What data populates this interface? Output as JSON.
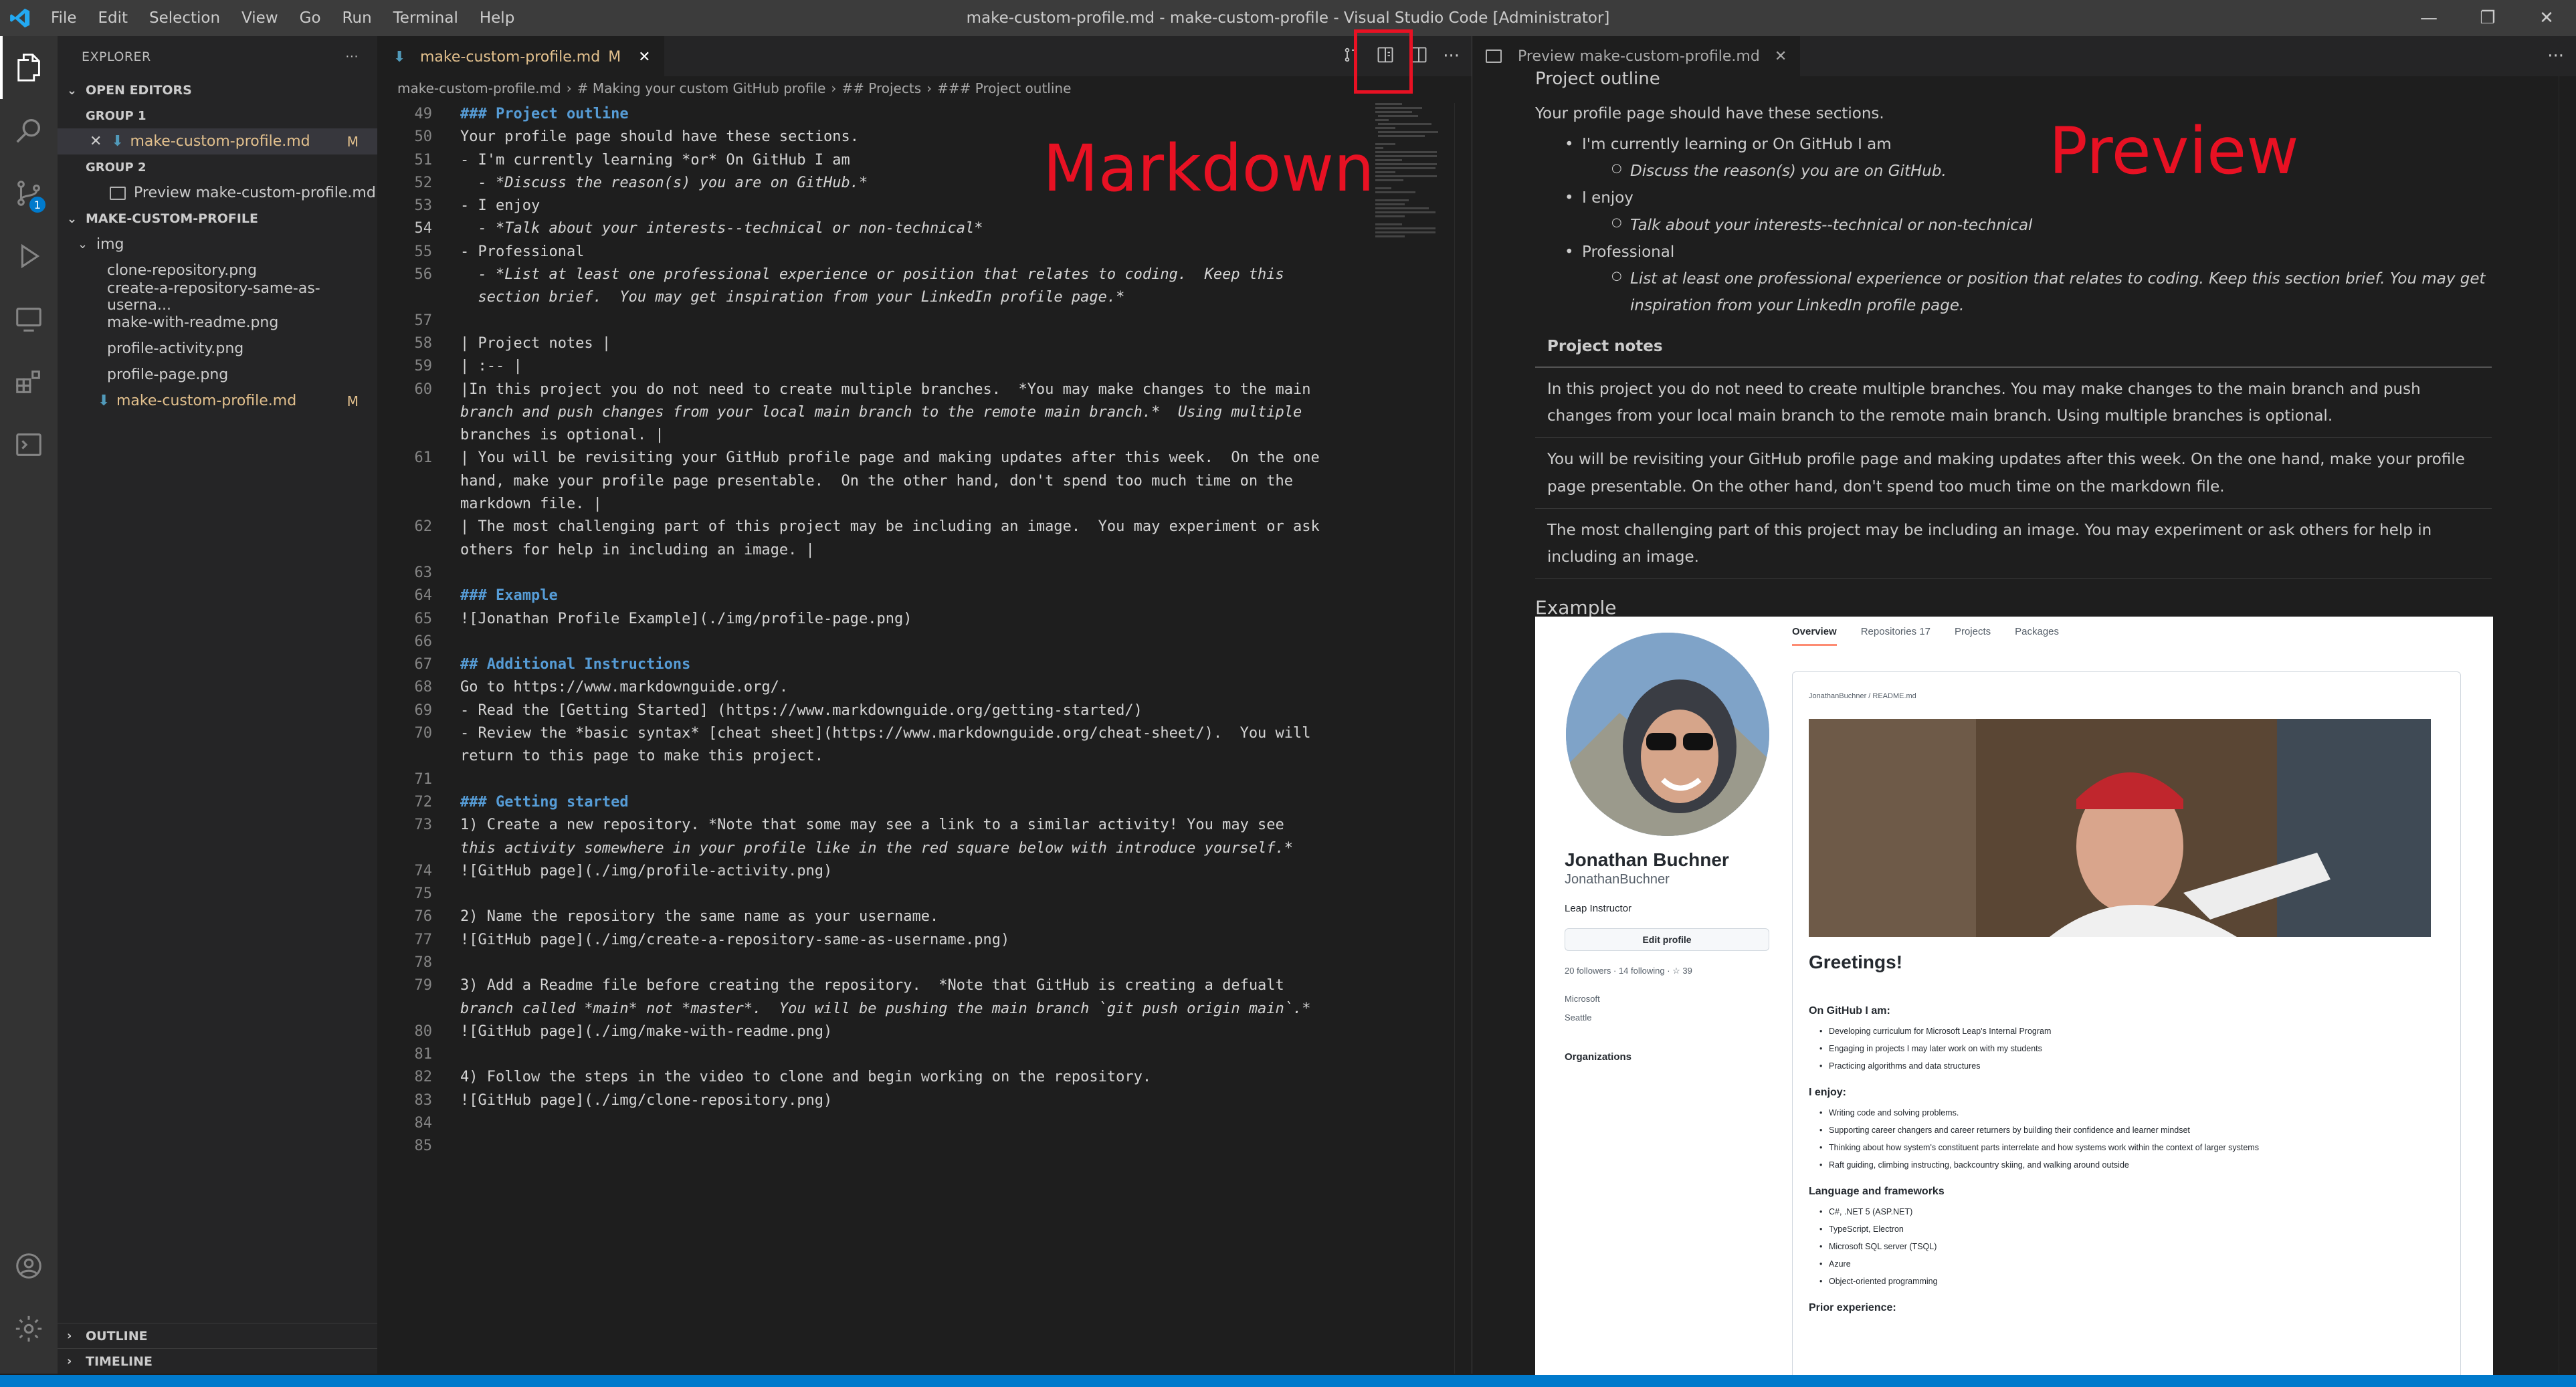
{
  "window": {
    "title": "make-custom-profile.md - make-custom-profile - Visual Studio Code [Administrator]",
    "menu": [
      "File",
      "Edit",
      "Selection",
      "View",
      "Go",
      "Run",
      "Terminal",
      "Help"
    ]
  },
  "activity": {
    "scm_badge": "1"
  },
  "sidebar": {
    "header": "EXPLORER",
    "open_editors": "OPEN EDITORS",
    "group1": "GROUP 1",
    "group1_file": "make-custom-profile.md",
    "group1_mod": "M",
    "group2": "GROUP 2",
    "group2_file": "Preview make-custom-profile.md",
    "project": "MAKE-CUSTOM-PROFILE",
    "folder": "img",
    "files": [
      "clone-repository.png",
      "create-a-repository-same-as-userna...",
      "make-with-readme.png",
      "profile-activity.png",
      "profile-page.png"
    ],
    "root_file": "make-custom-profile.md",
    "root_mod": "M",
    "outline": "OUTLINE",
    "timeline": "TIMELINE"
  },
  "editor": {
    "tab_label": "make-custom-profile.md",
    "tab_mod": "M",
    "breadcrumb": [
      "make-custom-profile.md",
      "# Making your custom GitHub profile",
      "## Projects",
      "### Project outline"
    ],
    "overlay_label": "Markdown",
    "lines": [
      {
        "n": "49",
        "t": "### Project outline",
        "s": "hl"
      },
      {
        "n": "50",
        "t": "Your profile page should have these sections.",
        "s": ""
      },
      {
        "n": "51",
        "t": "- I'm currently learning *or* On GitHub I am",
        "s": ""
      },
      {
        "n": "52",
        "t": "  - *Discuss the reason(s) you are on GitHub.*",
        "s": "it"
      },
      {
        "n": "53",
        "t": "- I enjoy",
        "s": ""
      },
      {
        "n": "54",
        "t": "  - *Talk about your interests--technical or non-technical*",
        "s": "it"
      },
      {
        "n": "55",
        "t": "- Professional",
        "s": ""
      },
      {
        "n": "56",
        "t": "  - *List at least one professional experience or position that relates to coding.  Keep this",
        "s": "it"
      },
      {
        "n": "",
        "t": "  section brief.  You may get inspiration from your LinkedIn profile page.*",
        "s": "it"
      },
      {
        "n": "57",
        "t": "",
        "s": ""
      },
      {
        "n": "58",
        "t": "| Project notes |",
        "s": ""
      },
      {
        "n": "59",
        "t": "| :-- |",
        "s": ""
      },
      {
        "n": "60",
        "t": "|In this project you do not need to create multiple branches.  *You may make changes to the main",
        "s": ""
      },
      {
        "n": "",
        "t": "branch and push changes from your local main branch to the remote main branch.*  Using multiple",
        "s": "it"
      },
      {
        "n": "",
        "t": "branches is optional. |",
        "s": ""
      },
      {
        "n": "61",
        "t": "| You will be revisiting your GitHub profile page and making updates after this week.  On the one",
        "s": ""
      },
      {
        "n": "",
        "t": "hand, make your profile page presentable.  On the other hand, don't spend too much time on the",
        "s": ""
      },
      {
        "n": "",
        "t": "markdown file. |",
        "s": ""
      },
      {
        "n": "62",
        "t": "| The most challenging part of this project may be including an image.  You may experiment or ask",
        "s": ""
      },
      {
        "n": "",
        "t": "others for help in including an image. |",
        "s": ""
      },
      {
        "n": "63",
        "t": "",
        "s": ""
      },
      {
        "n": "64",
        "t": "### Example",
        "s": "hl"
      },
      {
        "n": "65",
        "t": "![Jonathan Profile Example](./img/profile-page.png)",
        "s": ""
      },
      {
        "n": "66",
        "t": "",
        "s": ""
      },
      {
        "n": "67",
        "t": "## Additional Instructions",
        "s": "hl"
      },
      {
        "n": "68",
        "t": "Go to https://www.markdownguide.org/.",
        "s": ""
      },
      {
        "n": "69",
        "t": "- Read the [Getting Started] (https://www.markdownguide.org/getting-started/)",
        "s": ""
      },
      {
        "n": "70",
        "t": "- Review the *basic syntax* [cheat sheet](https://www.markdownguide.org/cheat-sheet/).  You will",
        "s": ""
      },
      {
        "n": "",
        "t": "return to this page to make this project.",
        "s": ""
      },
      {
        "n": "71",
        "t": "",
        "s": ""
      },
      {
        "n": "72",
        "t": "### Getting started",
        "s": "hl"
      },
      {
        "n": "73",
        "t": "1) Create a new repository. *Note that some may see a link to a similar activity! You may see",
        "s": ""
      },
      {
        "n": "",
        "t": "this activity somewhere in your profile like in the red square below with introduce yourself.*",
        "s": "it"
      },
      {
        "n": "74",
        "t": "![GitHub page](./img/profile-activity.png)",
        "s": ""
      },
      {
        "n": "75",
        "t": "",
        "s": ""
      },
      {
        "n": "76",
        "t": "2) Name the repository the same name as your username.",
        "s": ""
      },
      {
        "n": "77",
        "t": "![GitHub page](./img/create-a-repository-same-as-username.png)",
        "s": ""
      },
      {
        "n": "78",
        "t": "",
        "s": ""
      },
      {
        "n": "79",
        "t": "3) Add a Readme file before creating the repository.  *Note that GitHub is creating a defualt",
        "s": ""
      },
      {
        "n": "",
        "t": "branch called *main* not *master*.  You will be pushing the main branch `git push origin main`.*",
        "s": "it"
      },
      {
        "n": "80",
        "t": "![GitHub page](./img/make-with-readme.png)",
        "s": ""
      },
      {
        "n": "81",
        "t": "",
        "s": ""
      },
      {
        "n": "82",
        "t": "4) Follow the steps in the video to clone and begin working on the repository.",
        "s": ""
      },
      {
        "n": "83",
        "t": "![GitHub page](./img/clone-repository.png)",
        "s": ""
      },
      {
        "n": "84",
        "t": "",
        "s": ""
      },
      {
        "n": "85",
        "t": "",
        "s": ""
      }
    ]
  },
  "preview": {
    "tab_label": "Preview make-custom-profile.md",
    "overlay_label": "Preview",
    "heading": "Project outline",
    "intro": "Your profile page should have these sections.",
    "items": [
      {
        "label": "I'm currently learning or On GitHub I am",
        "sub": "Discuss the reason(s) you are on GitHub."
      },
      {
        "label": "I enjoy",
        "sub": "Talk about your interests--technical or non-technical"
      },
      {
        "label": "Professional",
        "sub": "List at least one professional experience or position that relates to coding. Keep this section brief. You may get inspiration from your LinkedIn profile page."
      }
    ],
    "table_header": "Project notes",
    "table_rows": [
      "In this project you do not need to create multiple branches. You may make changes to the main branch and push changes from your local main branch to the remote main branch. Using multiple branches is optional.",
      "You will be revisiting your GitHub profile page and making updates after this week. On the one hand, make your profile page presentable. On the other hand, don't spend too much time on the markdown file.",
      "The most challenging part of this project may be including an image. You may experiment or ask others for help in including an image."
    ],
    "example_heading": "Example"
  },
  "profile": {
    "tabs": [
      "Overview",
      "Repositories 17",
      "Projects",
      "Packages"
    ],
    "name": "Jonathan Buchner",
    "username": "JonathanBuchner",
    "role": "Leap Instructor",
    "edit_button": "Edit profile",
    "followers": "20 followers · 14 following · ☆ 39",
    "org_company": "Microsoft",
    "org_location": "Seattle",
    "orgs_title": "Organizations",
    "readme_path": "JonathanBuchner / README.md",
    "greeting": "Greetings!",
    "sec1_title": "On GitHub I am:",
    "sec1": [
      "Developing curriculum for Microsoft Leap's Internal Program",
      "Engaging in projects I may later work on with my students",
      "Practicing algorithms and data structures"
    ],
    "sec2_title": "I enjoy:",
    "sec2": [
      "Writing code and solving problems.",
      "Supporting career changers and career returners by building their confidence and learner mindset",
      "Thinking about how system's constituent parts interrelate and how systems work within the context of larger systems",
      "Raft guiding, climbing instructing, backcountry skiing, and walking around outside"
    ],
    "sec3_title": "Language and frameworks",
    "sec3": [
      "C#, .NET 5 (ASP.NET)",
      "TypeScript, Electron",
      "Microsoft SQL server (TSQL)",
      "Azure",
      "Object-oriented programming"
    ],
    "sec4_title": "Prior experience:"
  }
}
